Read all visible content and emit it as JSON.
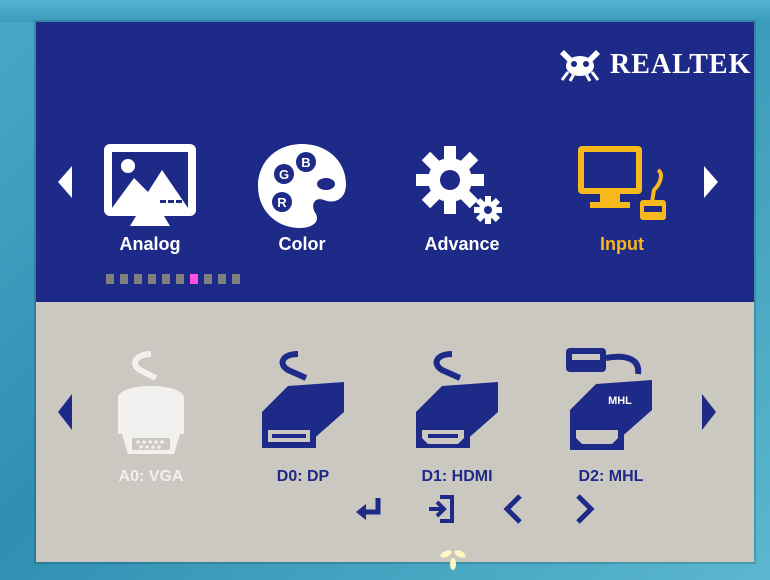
{
  "osd": {
    "brand": "REALTEK",
    "menu": [
      {
        "label": "Analog",
        "icon": "picture-icon",
        "active": false
      },
      {
        "label": "Color",
        "icon": "palette-icon",
        "active": false
      },
      {
        "label": "Advance",
        "icon": "gear-icon",
        "active": false
      },
      {
        "label": "Input",
        "icon": "monitor-input-icon",
        "active": true
      }
    ],
    "palette_letters": [
      "G",
      "B",
      "R"
    ],
    "page_dots": {
      "count": 10,
      "active_index": 6
    },
    "inputs": [
      {
        "label": "A0: VGA",
        "icon": "vga-icon",
        "enabled": false
      },
      {
        "label": "D0: DP",
        "icon": "displayport-icon",
        "enabled": true
      },
      {
        "label": "D1: HDMI",
        "icon": "hdmi-icon",
        "enabled": true
      },
      {
        "label": "D2: MHL",
        "icon": "mhl-icon",
        "enabled": true,
        "badge": "MHL"
      }
    ],
    "nav_buttons": [
      "enter-icon",
      "exit-icon",
      "left-icon",
      "right-icon"
    ]
  },
  "colors": {
    "top_bg": "#1e2a88",
    "bottom_bg": "#cbc8c2",
    "active_text": "#f7b81b",
    "active_dot": "#ff4fe0",
    "bezel": "#3b9bbd"
  }
}
